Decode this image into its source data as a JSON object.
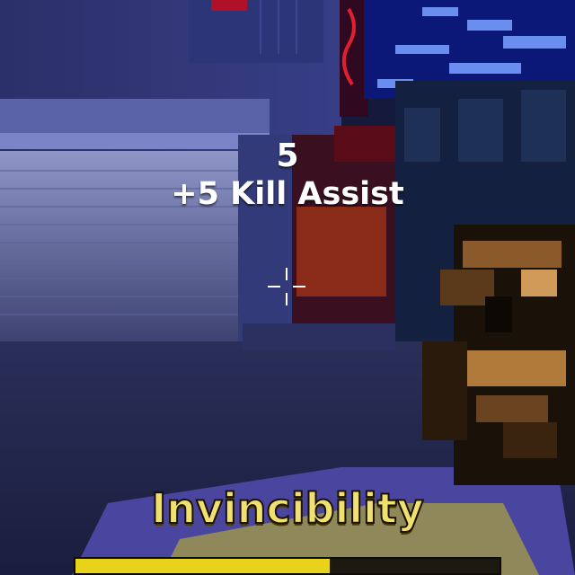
{
  "hud": {
    "score_value": "5",
    "kill_message": "+5 Kill Assist",
    "powerup_label": "Invincibility",
    "powerup_remaining_fraction": 0.6
  },
  "colors": {
    "powerup_text": "#f0e070",
    "powerup_bar_fill": "#e8d21a",
    "crosshair": "#ffffff"
  },
  "icons": {
    "crosshair": "crosshair-icon"
  }
}
